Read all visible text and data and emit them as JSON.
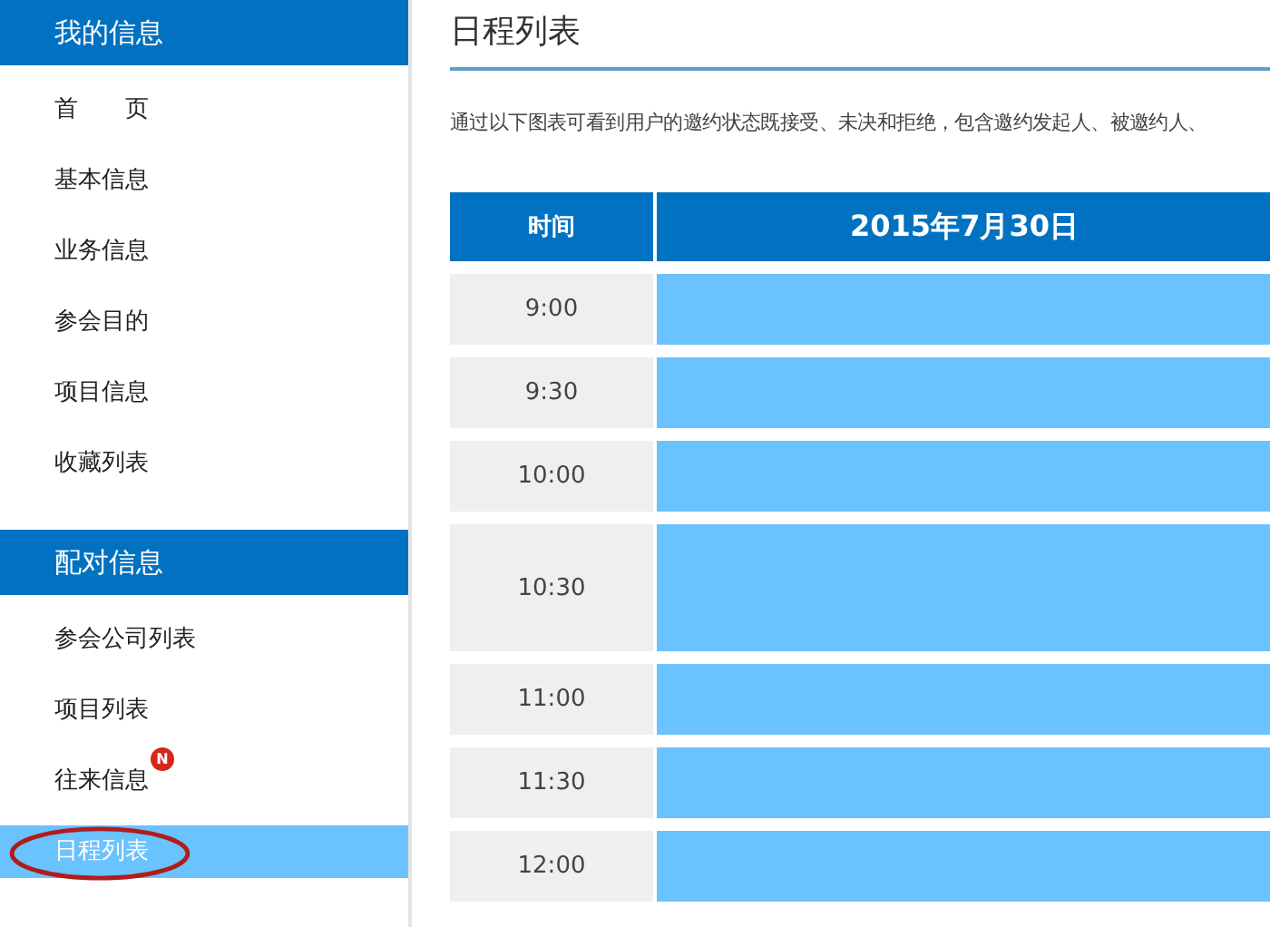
{
  "sidebar": {
    "sections": [
      {
        "title": "我的信息",
        "items": [
          {
            "label": "首　　页",
            "selected": false
          },
          {
            "label": "基本信息",
            "selected": false
          },
          {
            "label": "业务信息",
            "selected": false
          },
          {
            "label": "参会目的",
            "selected": false
          },
          {
            "label": "项目信息",
            "selected": false
          },
          {
            "label": "收藏列表",
            "selected": false
          }
        ]
      },
      {
        "title": "配对信息",
        "items": [
          {
            "label": "参会公司列表",
            "selected": false
          },
          {
            "label": "项目列表",
            "selected": false
          },
          {
            "label": "往来信息",
            "selected": false,
            "badge": "N"
          },
          {
            "label": "日程列表",
            "selected": true,
            "circled": true
          }
        ]
      }
    ]
  },
  "page": {
    "title": "日程列表",
    "description": "通过以下图表可看到用户的邀约状态既接受、未决和拒绝，包含邀约发起人、被邀约人、"
  },
  "table": {
    "columns": [
      "时间",
      "2015年7月30日"
    ],
    "rows": [
      {
        "time": "9:00",
        "tall": false
      },
      {
        "time": "9:30",
        "tall": false
      },
      {
        "time": "10:00",
        "tall": false
      },
      {
        "time": "10:30",
        "tall": true
      },
      {
        "time": "11:00",
        "tall": false
      },
      {
        "time": "11:30",
        "tall": false
      },
      {
        "time": "12:00",
        "tall": false
      }
    ]
  }
}
